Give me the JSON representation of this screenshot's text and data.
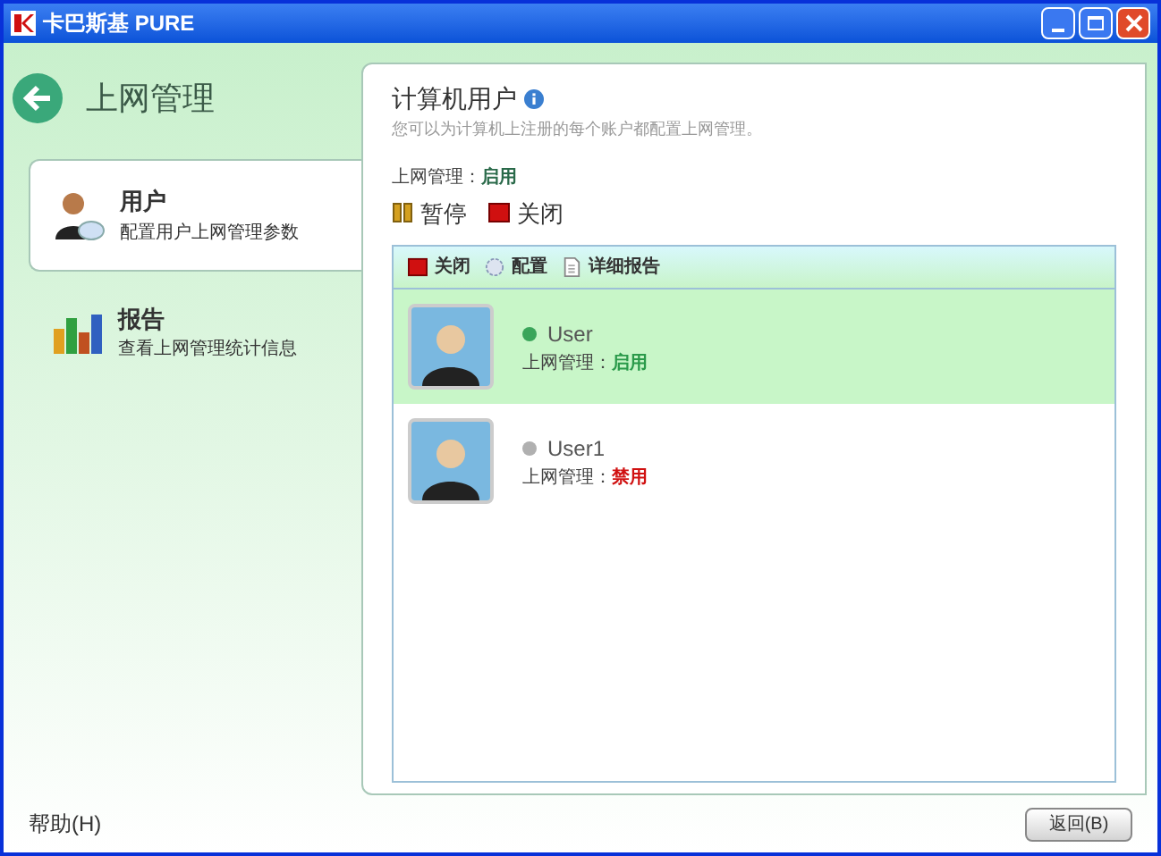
{
  "window": {
    "title": "卡巴斯基 PURE"
  },
  "header": {
    "title": "上网管理"
  },
  "nav": [
    {
      "title": "用户",
      "subtitle": "配置用户上网管理参数",
      "selected": true,
      "kind": "users"
    },
    {
      "title": "报告",
      "subtitle": "查看上网管理统计信息",
      "selected": false,
      "kind": "report"
    }
  ],
  "panel": {
    "title": "计算机用户",
    "description": "您可以为计算机上注册的每个账户都配置上网管理。",
    "status_label": "上网管理：",
    "status_value": "启用",
    "actions": [
      {
        "label": "暂停",
        "kind": "pause"
      },
      {
        "label": "关闭",
        "kind": "stop"
      }
    ],
    "toolbar": [
      {
        "label": "关闭",
        "kind": "stop"
      },
      {
        "label": "配置",
        "kind": "config"
      },
      {
        "label": "详细报告",
        "kind": "report"
      }
    ],
    "users": [
      {
        "name": "User",
        "status_label": "上网管理：",
        "status": "启用",
        "enabled": true,
        "selected": true,
        "color": "#3aa55a"
      },
      {
        "name": "User1",
        "status_label": "上网管理：",
        "status": "禁用",
        "enabled": false,
        "selected": false,
        "color": "#b0b0b0"
      }
    ]
  },
  "footer": {
    "help": "帮助(H)",
    "back_button": "返回(B)"
  }
}
